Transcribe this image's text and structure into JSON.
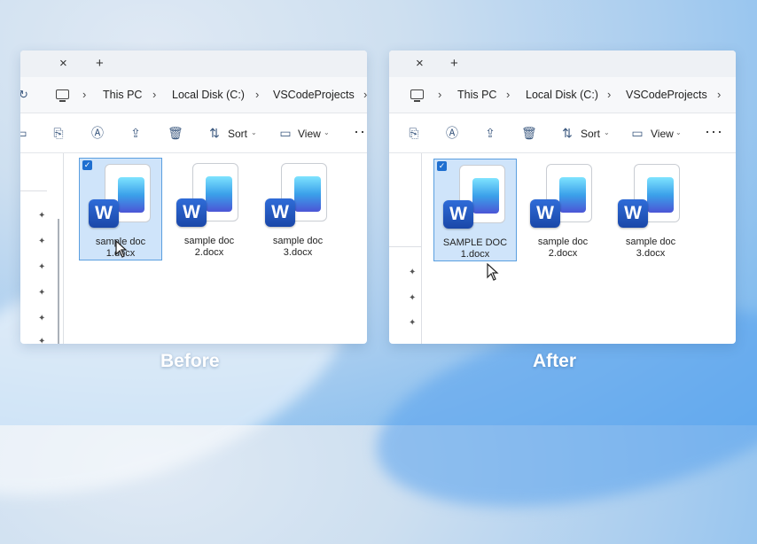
{
  "captions": {
    "before": "Before",
    "after": "After"
  },
  "panels": {
    "before": {
      "tabbar": {
        "close": "×",
        "add": "+"
      },
      "breadcrumb": [
        "This PC",
        "Local Disk (C:)",
        "VSCodeProjects"
      ],
      "toolbar": {
        "sort_label": "Sort",
        "view_label": "View",
        "more": "···"
      },
      "files": [
        {
          "line1": "sample doc",
          "line2": "1.docx",
          "selected": true
        },
        {
          "line1": "sample doc",
          "line2": "2.docx",
          "selected": false
        },
        {
          "line1": "sample doc",
          "line2": "3.docx",
          "selected": false
        }
      ]
    },
    "after": {
      "tabbar": {
        "close": "×",
        "add": "+"
      },
      "breadcrumb": [
        "This PC",
        "Local Disk (C:)",
        "VSCodeProjects"
      ],
      "toolbar": {
        "sort_label": "Sort",
        "view_label": "View",
        "more": "···"
      },
      "files": [
        {
          "line1": "SAMPLE DOC",
          "line2": "1.docx",
          "selected": true
        },
        {
          "line1": "sample doc",
          "line2": "2.docx",
          "selected": false
        },
        {
          "line1": "sample doc",
          "line2": "3.docx",
          "selected": false
        }
      ]
    }
  },
  "icons": {
    "word_letter": "W",
    "checkmark": "✓",
    "chevron": "›",
    "caret": "⌄",
    "pin": "📌"
  },
  "colors": {
    "word_badge": "#1a47a8",
    "selection_bg": "#cfe4fa",
    "selection_border": "#5b9fe0"
  }
}
